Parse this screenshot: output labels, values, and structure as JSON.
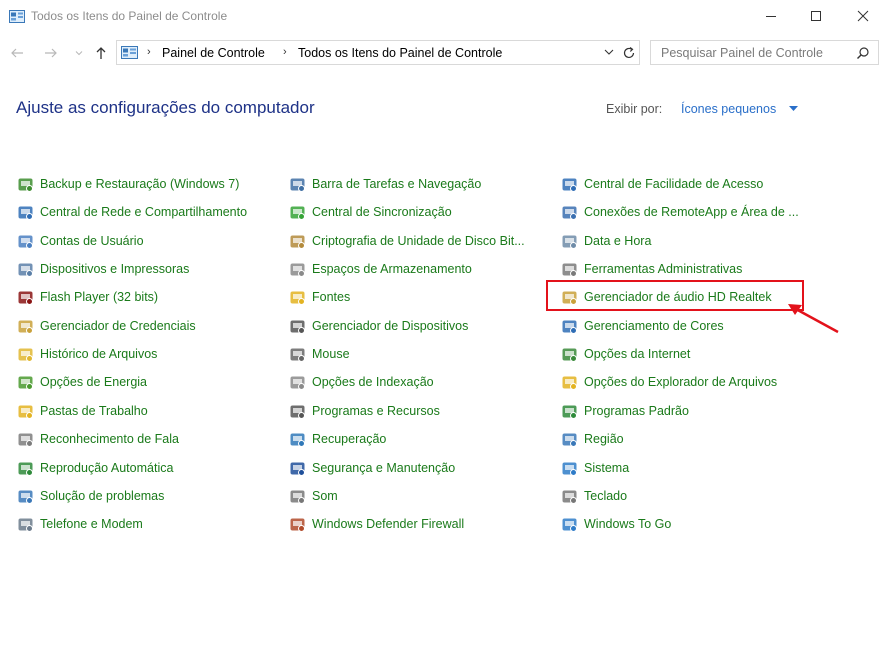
{
  "window": {
    "title": "Todos os Itens do Painel de Controle"
  },
  "address": {
    "crumbs": [
      "Painel de Controle",
      "Todos os Itens do Painel de Controle"
    ]
  },
  "search": {
    "placeholder": "Pesquisar Painel de Controle"
  },
  "header": {
    "heading": "Ajuste as configurações do computador",
    "view_by_label": "Exibir por:",
    "view_by_value": "Ícones pequenos"
  },
  "columns": [
    {
      "items": [
        {
          "label": "Backup e Restauração (Windows 7)",
          "icon": "backup-icon",
          "color": "#3c8d2f"
        },
        {
          "label": "Central de Rede e Compartilhamento",
          "icon": "network-icon",
          "color": "#2f6db5"
        },
        {
          "label": "Contas de Usuário",
          "icon": "users-icon",
          "color": "#4a7fc1"
        },
        {
          "label": "Dispositivos e Impressoras",
          "icon": "printer-icon",
          "color": "#5a7fa8"
        },
        {
          "label": "Flash Player (32 bits)",
          "icon": "flash-icon",
          "color": "#8a1414"
        },
        {
          "label": "Gerenciador de Credenciais",
          "icon": "credentials-icon",
          "color": "#c9a13a"
        },
        {
          "label": "Histórico de Arquivos",
          "icon": "file-history-icon",
          "color": "#e0b730"
        },
        {
          "label": "Opções de Energia",
          "icon": "power-icon",
          "color": "#4a9a2f"
        },
        {
          "label": "Pastas de Trabalho",
          "icon": "work-folders-icon",
          "color": "#e3b321"
        },
        {
          "label": "Reconhecimento de Fala",
          "icon": "microphone-icon",
          "color": "#7c7c7c"
        },
        {
          "label": "Reprodução Automática",
          "icon": "autoplay-icon",
          "color": "#2e8a3a"
        },
        {
          "label": "Solução de problemas",
          "icon": "troubleshoot-icon",
          "color": "#3a78b8"
        },
        {
          "label": "Telefone e Modem",
          "icon": "phone-modem-icon",
          "color": "#6b7b8b"
        }
      ]
    },
    {
      "items": [
        {
          "label": "Barra de Tarefas e Navegação",
          "icon": "taskbar-icon",
          "color": "#3f6fa3"
        },
        {
          "label": "Central de Sincronização",
          "icon": "sync-icon",
          "color": "#35a336"
        },
        {
          "label": "Criptografia de Unidade de Disco Bit...",
          "icon": "bitlocker-icon",
          "color": "#b38a3b"
        },
        {
          "label": "Espaços de Armazenamento",
          "icon": "storage-icon",
          "color": "#8a8a8a"
        },
        {
          "label": "Fontes",
          "icon": "fonts-icon",
          "color": "#e3b321"
        },
        {
          "label": "Gerenciador de Dispositivos",
          "icon": "device-manager-icon",
          "color": "#555555"
        },
        {
          "label": "Mouse",
          "icon": "mouse-icon",
          "color": "#666666"
        },
        {
          "label": "Opções de Indexação",
          "icon": "indexing-icon",
          "color": "#8a8a8a"
        },
        {
          "label": "Programas e Recursos",
          "icon": "programs-icon",
          "color": "#555555"
        },
        {
          "label": "Recuperação",
          "icon": "recovery-icon",
          "color": "#2f78b8"
        },
        {
          "label": "Segurança e Manutenção",
          "icon": "flag-icon",
          "color": "#1f4f9a"
        },
        {
          "label": "Som",
          "icon": "speaker-icon",
          "color": "#777777"
        },
        {
          "label": "Windows Defender Firewall",
          "icon": "firewall-icon",
          "color": "#b04a2a"
        }
      ]
    },
    {
      "items": [
        {
          "label": "Central de Facilidade de Acesso",
          "icon": "ease-of-access-icon",
          "color": "#2f6db5"
        },
        {
          "label": "Conexões de RemoteApp e Área de ...",
          "icon": "remoteapp-icon",
          "color": "#3a6fb0"
        },
        {
          "label": "Data e Hora",
          "icon": "clock-icon",
          "color": "#6f8ca8"
        },
        {
          "label": "Ferramentas Administrativas",
          "icon": "admin-tools-icon",
          "color": "#7a7a7a"
        },
        {
          "label": "Gerenciador de áudio HD Realtek",
          "icon": "realtek-audio-icon",
          "color": "#c9a13a"
        },
        {
          "label": "Gerenciamento de Cores",
          "icon": "color-management-icon",
          "color": "#2f6db5"
        },
        {
          "label": "Opções da Internet",
          "icon": "internet-options-icon",
          "color": "#3a8a3a"
        },
        {
          "label": "Opções do Explorador de Arquivos",
          "icon": "folder-options-icon",
          "color": "#e3b321"
        },
        {
          "label": "Programas Padrão",
          "icon": "default-programs-icon",
          "color": "#2e8a3a"
        },
        {
          "label": "Região",
          "icon": "region-icon",
          "color": "#3a78b8"
        },
        {
          "label": "Sistema",
          "icon": "system-icon",
          "color": "#2f7cc8"
        },
        {
          "label": "Teclado",
          "icon": "keyboard-icon",
          "color": "#777777"
        },
        {
          "label": "Windows To Go",
          "icon": "windows-to-go-icon",
          "color": "#2f7cc8"
        }
      ]
    }
  ],
  "colors": {
    "item_text": "#1a7a1a",
    "heading": "#1e3287",
    "link_blue": "#2a6fc9",
    "highlight": "#e3121b"
  }
}
